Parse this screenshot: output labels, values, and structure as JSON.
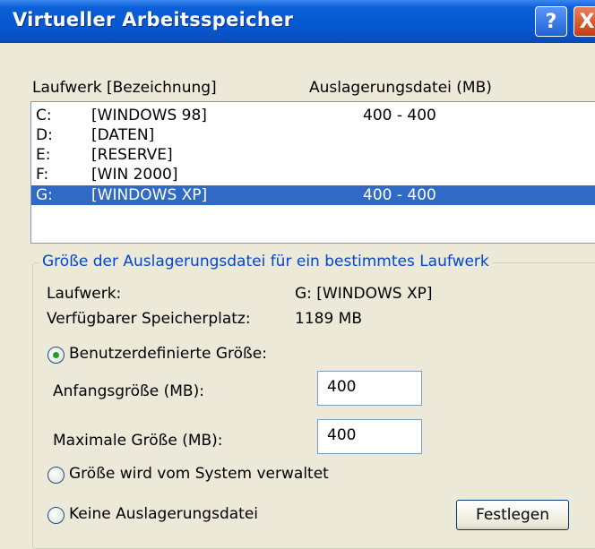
{
  "window": {
    "title": "Virtueller Arbeitsspeicher",
    "help_glyph": "?",
    "close_glyph": "X"
  },
  "list": {
    "col_drive": "Laufwerk [Bezeichnung]",
    "col_size": "Auslagerungsdatei (MB)",
    "rows": [
      {
        "drive": "C:",
        "label": "[WINDOWS 98]",
        "size": "400 - 400"
      },
      {
        "drive": "D:",
        "label": "[DATEN]",
        "size": ""
      },
      {
        "drive": "E:",
        "label": "[RESERVE]",
        "size": ""
      },
      {
        "drive": "F:",
        "label": "[WIN 2000]",
        "size": ""
      },
      {
        "drive": "G:",
        "label": "[WINDOWS XP]",
        "size": "400 - 400"
      }
    ]
  },
  "group": {
    "legend": "Größe der Auslagerungsdatei für ein bestimmtes Laufwerk",
    "drive_label": "Laufwerk:",
    "drive_value": "G:  [WINDOWS XP]",
    "space_label": "Verfügbarer Speicherplatz:",
    "space_value": "1189 MB",
    "radio_custom": "Benutzerdefinierte Größe:",
    "initial_label": "Anfangsgröße (MB):",
    "initial_value": "400",
    "max_label": "Maximale Größe (MB):",
    "max_value": "400",
    "radio_system": "Größe wird vom System verwaltet",
    "radio_none": "Keine Auslagerungsdatei",
    "set_button": "Festlegen"
  }
}
